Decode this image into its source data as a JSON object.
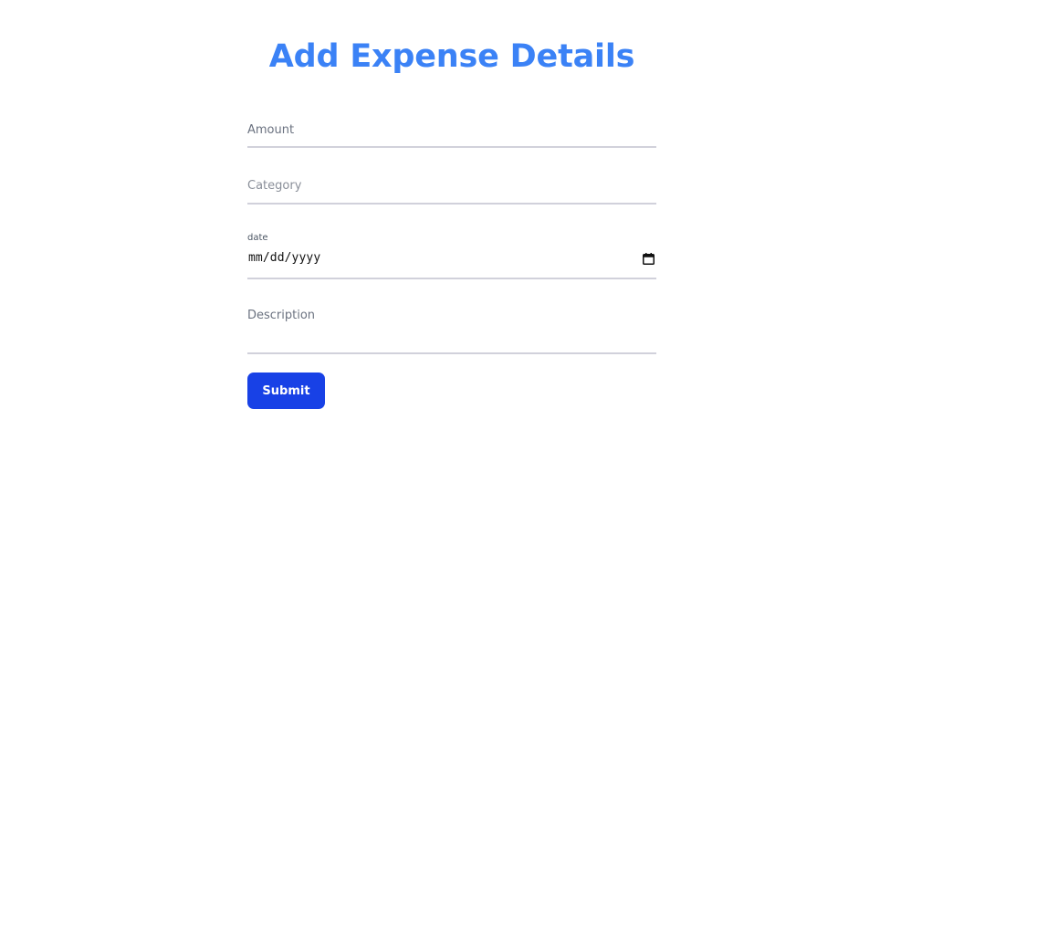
{
  "header": {
    "title": "Add Expense Details"
  },
  "form": {
    "amount": {
      "placeholder": "Amount",
      "value": ""
    },
    "category": {
      "placeholder": "Category",
      "value": ""
    },
    "date": {
      "label": "date",
      "value": "mm/dd/yyyy",
      "icon": "calendar-icon"
    },
    "description": {
      "placeholder": "Description",
      "value": ""
    },
    "submit_label": "Submit"
  },
  "colors": {
    "title": "#3b82f6",
    "button": "#1841e6",
    "underline": "#d1d1db"
  }
}
